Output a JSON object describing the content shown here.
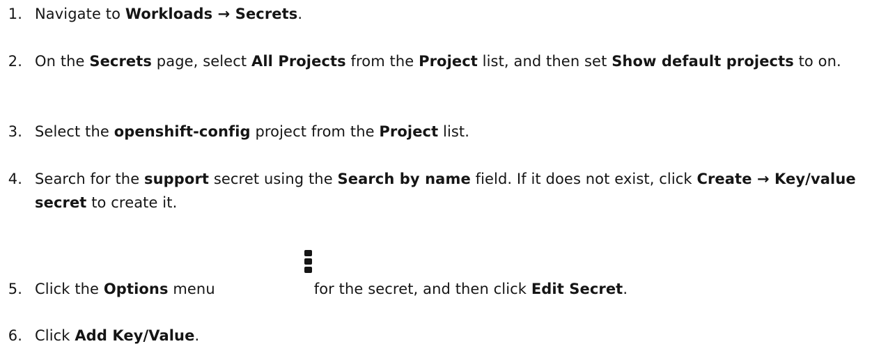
{
  "steps": [
    {
      "number": "1.",
      "parts": [
        "Navigate to ",
        "Workloads → Secrets",
        "."
      ]
    },
    {
      "number": "2.",
      "parts": [
        "On the ",
        "Secrets",
        " page, select ",
        "All Projects",
        " from the ",
        "Project",
        " list, and then set ",
        "Show default projects",
        " to on."
      ]
    },
    {
      "number": "3.",
      "parts": [
        "Select the ",
        "openshift-config",
        " project from the ",
        "Project",
        " list."
      ]
    },
    {
      "number": "4.",
      "parts": [
        "Search for the ",
        "support",
        " secret using the ",
        "Search by name",
        " field. If it does not exist, click ",
        "Create → Key/value secret",
        " to create it."
      ]
    },
    {
      "number": "5.",
      "parts": [
        "Click the ",
        "Options",
        " menu",
        "for the secret, and then click ",
        "Edit Secret",
        "."
      ],
      "icon": "kebab-options-icon"
    },
    {
      "number": "6.",
      "parts": [
        "Click ",
        "Add Key/Value",
        "."
      ]
    }
  ]
}
